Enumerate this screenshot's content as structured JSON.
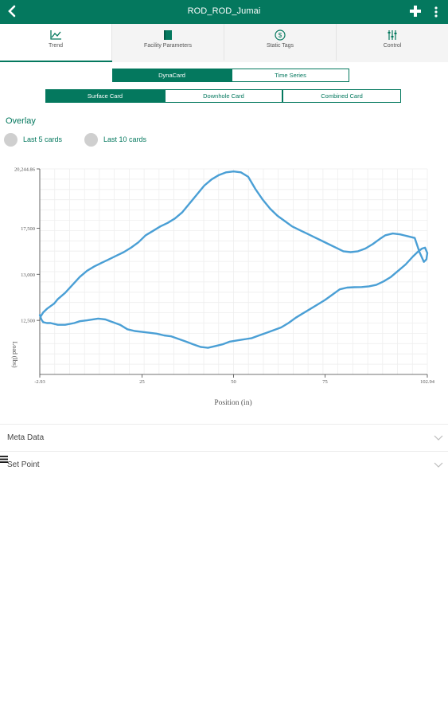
{
  "app": {
    "title": "ROD_ROD_Jumai"
  },
  "tabs": [
    {
      "label": "Trend",
      "icon": "trend-icon"
    },
    {
      "label": "Facility Parameters",
      "icon": "book-icon"
    },
    {
      "label": "Static Tags",
      "icon": "dollar-icon"
    },
    {
      "label": "Control",
      "icon": "control-icon"
    }
  ],
  "mode": {
    "options": [
      "DynaCard",
      "Time Series"
    ],
    "selected": "DynaCard"
  },
  "card": {
    "options": [
      "Surface Card",
      "Downhole Card",
      "Combined Card"
    ],
    "selected": "Surface Card"
  },
  "overlay": {
    "label": "Overlay",
    "options": [
      "Last 5 cards",
      "Last 10 cards"
    ]
  },
  "accent": "#04785e",
  "series_color": "#4a9fd5",
  "chart_data": {
    "type": "line",
    "xlabel": "Position (in)",
    "ylabel": "Load (lbs)",
    "xlim": [
      -2.93,
      102.94
    ],
    "ylim": [
      8650,
      20244.86
    ],
    "x_ticks": [
      "-2.93",
      "25",
      "50",
      "75",
      "102.94"
    ],
    "x_tick_values": [
      -2.93,
      25,
      50,
      75,
      102.94
    ],
    "y_ticks": [
      "12,500",
      "13,000",
      "17,500",
      "20,244.86"
    ],
    "y_tick_values": [
      11700,
      14300,
      16900,
      20244.86
    ],
    "grid": true,
    "series": [
      {
        "values_x": [
          -2.9,
          -2.5,
          -2.0,
          -1.0,
          0.0,
          2.0,
          4.0,
          6.5,
          8.0,
          10.0,
          13.0,
          15.0,
          17.0,
          19.0,
          21.0,
          23.0,
          25.0,
          27.0,
          29.0,
          31.0,
          33.0,
          35.0,
          37.0,
          39.0,
          41.0,
          43.0,
          45.0,
          47.0,
          49.0,
          50.5,
          52.0,
          53.5,
          55.0,
          57.0,
          59.0,
          61.0,
          63.0,
          65.0,
          67.0,
          69.0,
          71.0,
          73.0,
          75.0,
          77.0,
          79.0,
          81.0,
          83.0,
          85.0,
          87.0,
          89.0,
          91.0,
          93.0,
          95.0,
          97.0,
          99.0,
          100.5,
          101.5,
          102.3,
          102.94,
          102.7,
          102.0,
          100.8,
          99.5,
          97.5,
          95.5,
          93.5,
          91.5,
          90.0,
          88.0,
          86.0,
          84.0,
          82.0,
          80.0,
          78.0,
          76.0,
          74.0,
          72.0,
          70.0,
          68.0,
          66.0,
          64.0,
          62.0,
          60.0,
          58.0,
          56.0,
          54.0,
          52.0,
          50.0,
          48.0,
          46.0,
          44.0,
          42.0,
          40.0,
          38.0,
          36.0,
          34.0,
          32.0,
          30.0,
          28.0,
          26.0,
          24.0,
          22.0,
          20.0,
          18.0,
          16.0,
          14.0,
          12.0,
          10.0,
          8.0,
          6.0,
          4.0,
          2.0,
          1.0,
          0.0,
          -1.0,
          -2.0,
          -2.6,
          -2.9
        ],
        "values_y": [
          12000,
          11750,
          11600,
          11550,
          11550,
          11450,
          11450,
          11550,
          11650,
          11700,
          11800,
          11750,
          11600,
          11450,
          11200,
          11100,
          11050,
          11000,
          10950,
          10850,
          10800,
          10650,
          10500,
          10350,
          10200,
          10150,
          10250,
          10350,
          10500,
          10550,
          10600,
          10650,
          10700,
          10850,
          11000,
          11150,
          11300,
          11550,
          11850,
          12100,
          12350,
          12600,
          12850,
          13150,
          13450,
          13550,
          13570,
          13580,
          13620,
          13700,
          13900,
          14150,
          14500,
          14850,
          15300,
          15600,
          15750,
          15800,
          15500,
          15150,
          15000,
          15550,
          16350,
          16450,
          16550,
          16600,
          16500,
          16300,
          16000,
          15750,
          15600,
          15550,
          15600,
          15800,
          16000,
          16200,
          16400,
          16600,
          16800,
          17000,
          17300,
          17600,
          18000,
          18500,
          19100,
          19800,
          20050,
          20100,
          20050,
          19900,
          19650,
          19300,
          18800,
          18300,
          17800,
          17450,
          17200,
          17000,
          16750,
          16500,
          16100,
          15800,
          15550,
          15350,
          15150,
          14950,
          14750,
          14500,
          14150,
          13700,
          13250,
          12900,
          12650,
          12500,
          12350,
          12150,
          11950,
          12000
        ],
        "name": ""
      }
    ]
  }
}
